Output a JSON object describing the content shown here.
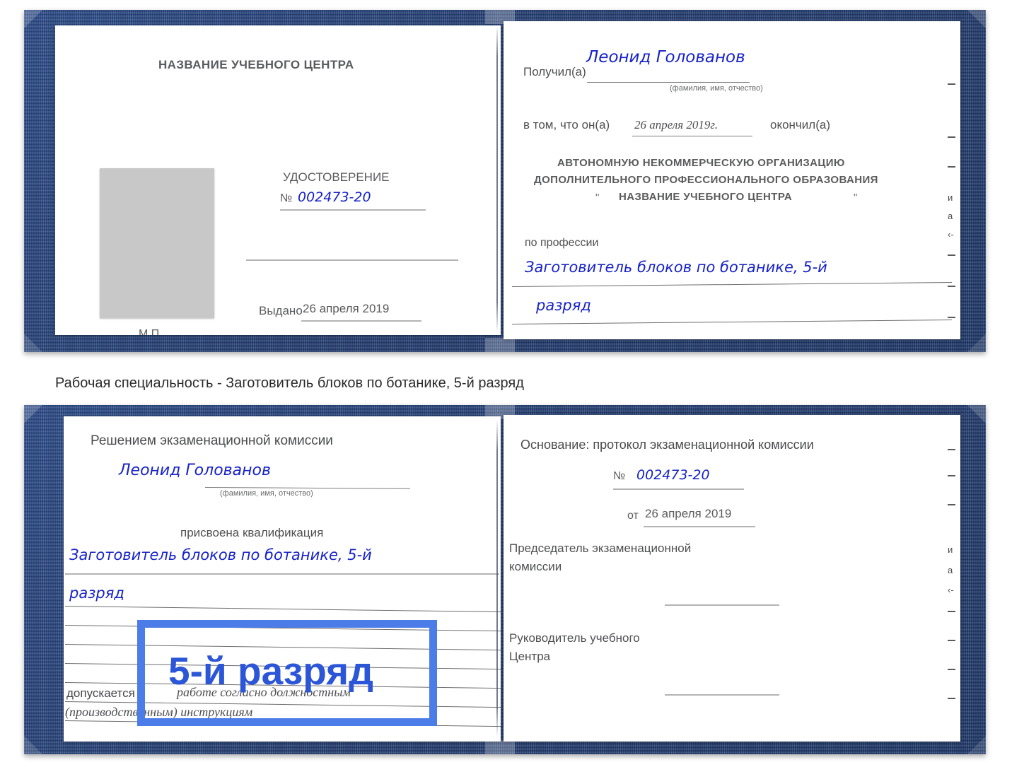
{
  "document": {
    "type": "Удостоверение",
    "caption": "Рабочая специальность - Заготовитель блоков по ботанике, 5-й разряд"
  },
  "top_certificate": {
    "left_page": {
      "center_name": "НАЗВАНИЕ УЧЕБНОГО ЦЕНТРА",
      "doc_title": "УДОСТОВЕРЕНИЕ",
      "number_symbol": "№",
      "number_value": "002473-20",
      "issued_label": "Выдано",
      "issued_value": "26 апреля 2019",
      "stamp_label": "М.П."
    },
    "right_page": {
      "received_label": "Получил(а)",
      "received_value": "Леонид Голованов",
      "fio_hint": "(фамилия, имя, отчество)",
      "that_he_label": "в том, что он(а)",
      "that_he_value": "26 апреля 2019г.",
      "finished_label": "окончил(а)",
      "org_line1": "АВТОНОМНУЮ НЕКОММЕРЧЕСКУЮ ОРГАНИЗАЦИЮ",
      "org_line2": "ДОПОЛНИТЕЛЬНОГО ПРОФЕССИОНАЛЬНОГО ОБРАЗОВАНИЯ",
      "org_quote_open": "\"",
      "org_name": "НАЗВАНИЕ УЧЕБНОГО ЦЕНТРА",
      "org_quote_close": "\"",
      "profession_label": "по профессии",
      "profession_value_line1": "Заготовитель блоков по ботанике, 5-й",
      "profession_value_line2": "разряд"
    }
  },
  "bottom_certificate": {
    "left_page": {
      "decision_label": "Решением экзаменационной комиссии",
      "name_value": "Леонид Голованов",
      "fio_hint": "(фамилия, имя, отчество)",
      "qualification_label": "присвоена квалификация",
      "qualification_line1": "Заготовитель блоков по ботанике, 5-й",
      "qualification_line2": "разряд",
      "highlight_text": "5-й разряд",
      "admitted_label": "допускается к",
      "admitted_value_line1": "работе согласно должностным",
      "admitted_value_line2": "(производственным) инструкциям"
    },
    "right_page": {
      "basis_label": "Основание: протокол экзаменационной комиссии",
      "number_symbol": "№",
      "number_value": "002473-20",
      "date_label": "от",
      "date_value": "26 апреля 2019",
      "chairman_line1": "Председатель экзаменационной",
      "chairman_line2": "комиссии",
      "head_line1": "Руководитель учебного",
      "head_line2": "Центра"
    }
  },
  "margin_fragments": {
    "f1": "и",
    "f2": "а",
    "f3": "‹-"
  },
  "colors": {
    "cover_blue": "#264178",
    "handwriting_blue": "#1722c8",
    "highlight_blue": "#4c7ce8",
    "highlight_text_blue": "#2c56d8",
    "print_gray": "#58595b",
    "photo_gray": "#c8c8c8"
  }
}
